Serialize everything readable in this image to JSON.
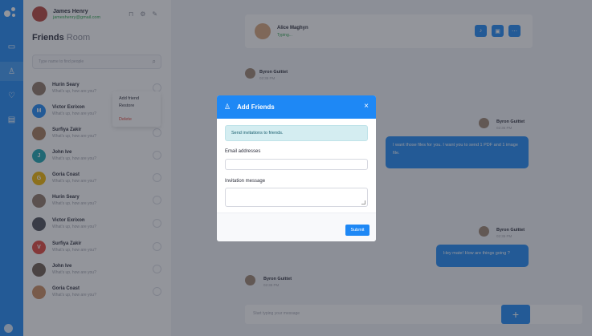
{
  "user": {
    "name": "James Henry",
    "email": "jameshenry@gmail.com"
  },
  "sidebar_title": {
    "bold": "Friends",
    "light": "Room"
  },
  "search": {
    "placeholder": "Type name to find people"
  },
  "friends": [
    {
      "name": "Hurin Seary",
      "status": "What's up, how are you?",
      "initial": "",
      "color": "#8e7767"
    },
    {
      "name": "Victor Exrixon",
      "status": "What's up, how are you?",
      "initial": "M",
      "color": "#1e88f5"
    },
    {
      "name": "Surfiya Zakir",
      "status": "What's up, how are you?",
      "initial": "",
      "color": "#a57a5b"
    },
    {
      "name": "John Ive",
      "status": "What's up, how are you?",
      "initial": "J",
      "color": "#1aa5b0"
    },
    {
      "name": "Goria Coast",
      "status": "What's up, how are you?",
      "initial": "G",
      "color": "#f0b400"
    },
    {
      "name": "Hurin Seary",
      "status": "What's up, how are you?",
      "initial": "",
      "color": "#8e7767"
    },
    {
      "name": "Victor Exrixon",
      "status": "What's up, how are you?",
      "initial": "",
      "color": "#4b4d57"
    },
    {
      "name": "Surfiya Zakir",
      "status": "What's up, how are you?",
      "initial": "V",
      "color": "#e0443a"
    },
    {
      "name": "John Ive",
      "status": "What's up, how are you?",
      "initial": "",
      "color": "#6d5a4e"
    },
    {
      "name": "Goria Coast",
      "status": "What's up, how are you?",
      "initial": "",
      "color": "#c88a5f"
    }
  ],
  "context_menu": {
    "add": "Add friend",
    "restore": "Restore",
    "delete": "Delete"
  },
  "chat": {
    "contact": "Alice Maghyn",
    "contact_status": "Typing...",
    "messages": [
      {
        "name": "Byron Guittet",
        "time": "02:35 PM"
      },
      {
        "name": "Byron Guittet",
        "time": "02:35 PM",
        "text": "I want those files for you. I want you to send 1 PDF and 1 image file."
      },
      {
        "name": "Byron Guittet",
        "time": "02:35 PM",
        "text": "Hey mate! How are things going ?"
      },
      {
        "name": "Byron Guittet",
        "time": "02:35 PM"
      }
    ],
    "composer_placeholder": "Start typing your message",
    "send_icon": "+"
  },
  "modal": {
    "title": "Add Friends",
    "close": "×",
    "alert": "Send invitations to friends.",
    "email_label": "Email addresses",
    "message_label": "Invitation message",
    "submit": "Submit"
  },
  "colors": {
    "accent": "#1e88f5",
    "alert_bg": "#d4edf1",
    "online": "#2ea44f",
    "danger": "#e0443a"
  }
}
